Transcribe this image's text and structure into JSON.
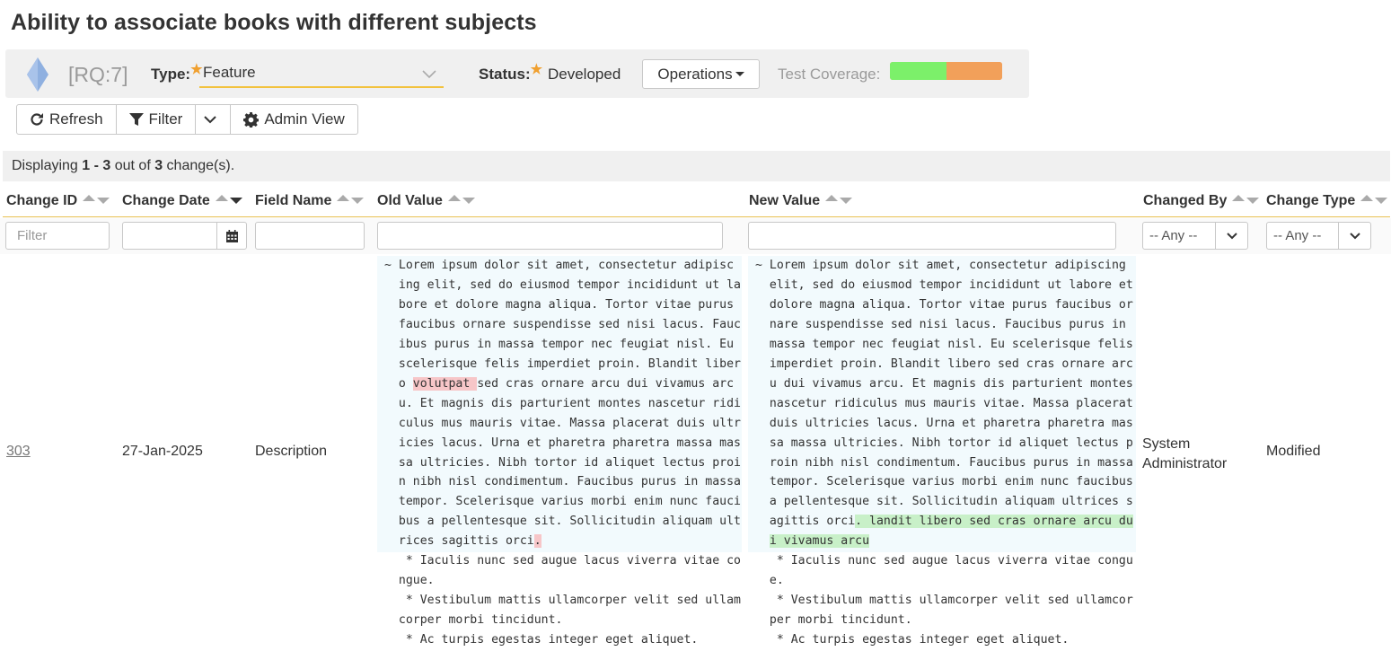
{
  "page_title": "Ability to associate books with different subjects",
  "header": {
    "rq_id": "[RQ:7]",
    "type_label": "Type:",
    "type_value": "Feature",
    "status_label": "Status:",
    "status_value": "Developed",
    "operations_label": "Operations",
    "coverage_label": "Test Coverage:",
    "coverage_pass_fraction": 0.5,
    "colors": {
      "coverage_pass": "#7cf06a",
      "coverage_fail": "#f2a05a",
      "accent": "#f2c23e",
      "diamond": "#8fb0e0"
    }
  },
  "toolbar": {
    "refresh_label": "Refresh",
    "filter_label": "Filter",
    "admin_label": "Admin View"
  },
  "display": {
    "prefix": "Displaying ",
    "range": "1 - 3",
    "middle": " out of ",
    "total": "3",
    "suffix": " change(s)."
  },
  "columns": [
    "Change ID",
    "Change Date",
    "Field Name",
    "Old Value",
    "New Value",
    "Changed By",
    "Change Type"
  ],
  "filters": {
    "id_placeholder": "Filter",
    "any_label": "-- Any --"
  },
  "row": {
    "change_id": "303",
    "change_date": "27-Jan-2025",
    "field_name": "Description",
    "changed_by_line1": "System",
    "changed_by_line2": "Administrator",
    "change_type": "Modified"
  },
  "old_value": {
    "lines": [
      "~ Lorem ipsum dolor sit amet, consectetur adipisc",
      "  ing elit, sed do eiusmod tempor incididunt ut la",
      "  bore et dolore magna aliqua. Tortor vitae purus",
      "  faucibus ornare suspendisse sed nisi lacus. Fauc",
      "  ibus purus in massa tempor nec feugiat nisl. Eu",
      "  scelerisque felis imperdiet proin. Blandit liber",
      "  o ",
      "  u. Et magnis dis parturient montes nascetur ridi",
      "  culus mus mauris vitae. Massa placerat duis ultr",
      "  icies lacus. Urna et pharetra pharetra massa mas",
      "  sa ultricies. Nibh tortor id aliquet lectus proi",
      "  n nibh nisl condimentum. Faucibus purus in massa",
      "  tempor. Scelerisque varius morbi enim nunc fauci",
      "  bus a pellentesque sit. Sollicitudin aliquam ult",
      "  rices sagittis orci"
    ],
    "line7_deleted": "volutpat ",
    "line7_rest": "sed cras ornare arcu dui vivamus arc",
    "line15_deleted": ".",
    "extra_lines": [
      "   * Iaculis nunc sed augue lacus viverra vitae co",
      "  ngue.",
      "   * Vestibulum mattis ullamcorper velit sed ullam",
      "  corper morbi tincidunt.",
      "   * Ac turpis egestas integer eget aliquet."
    ]
  },
  "new_value": {
    "lines": [
      "~ Lorem ipsum dolor sit amet, consectetur adipiscing",
      "  elit, sed do eiusmod tempor incididunt ut labore et",
      "  dolore magna aliqua. Tortor vitae purus faucibus or",
      "  nare suspendisse sed nisi lacus. Faucibus purus in",
      "  massa tempor nec feugiat nisl. Eu scelerisque felis",
      "  imperdiet proin. Blandit libero sed cras ornare arc",
      "  u dui vivamus arcu. Et magnis dis parturient montes",
      "  nascetur ridiculus mus mauris vitae. Massa placerat",
      "  duis ultricies lacus. Urna et pharetra pharetra mas",
      "  sa massa ultricies. Nibh tortor id aliquet lectus p",
      "  roin nibh nisl condimentum. Faucibus purus in massa",
      "  tempor. Scelerisque varius morbi enim nunc faucibus",
      "  a pellentesque sit. Sollicitudin aliquam ultrices s",
      "  agittis orci"
    ],
    "line14_added": ". landit libero sed cras ornare arcu du",
    "line15_added": "i vivamus arcu",
    "extra_lines": [
      "   * Iaculis nunc sed augue lacus viverra vitae congu",
      "  e.",
      "   * Vestibulum mattis ullamcorper velit sed ullamcor",
      "  per morbi tincidunt.",
      "   * Ac turpis egestas integer eget aliquet."
    ]
  }
}
